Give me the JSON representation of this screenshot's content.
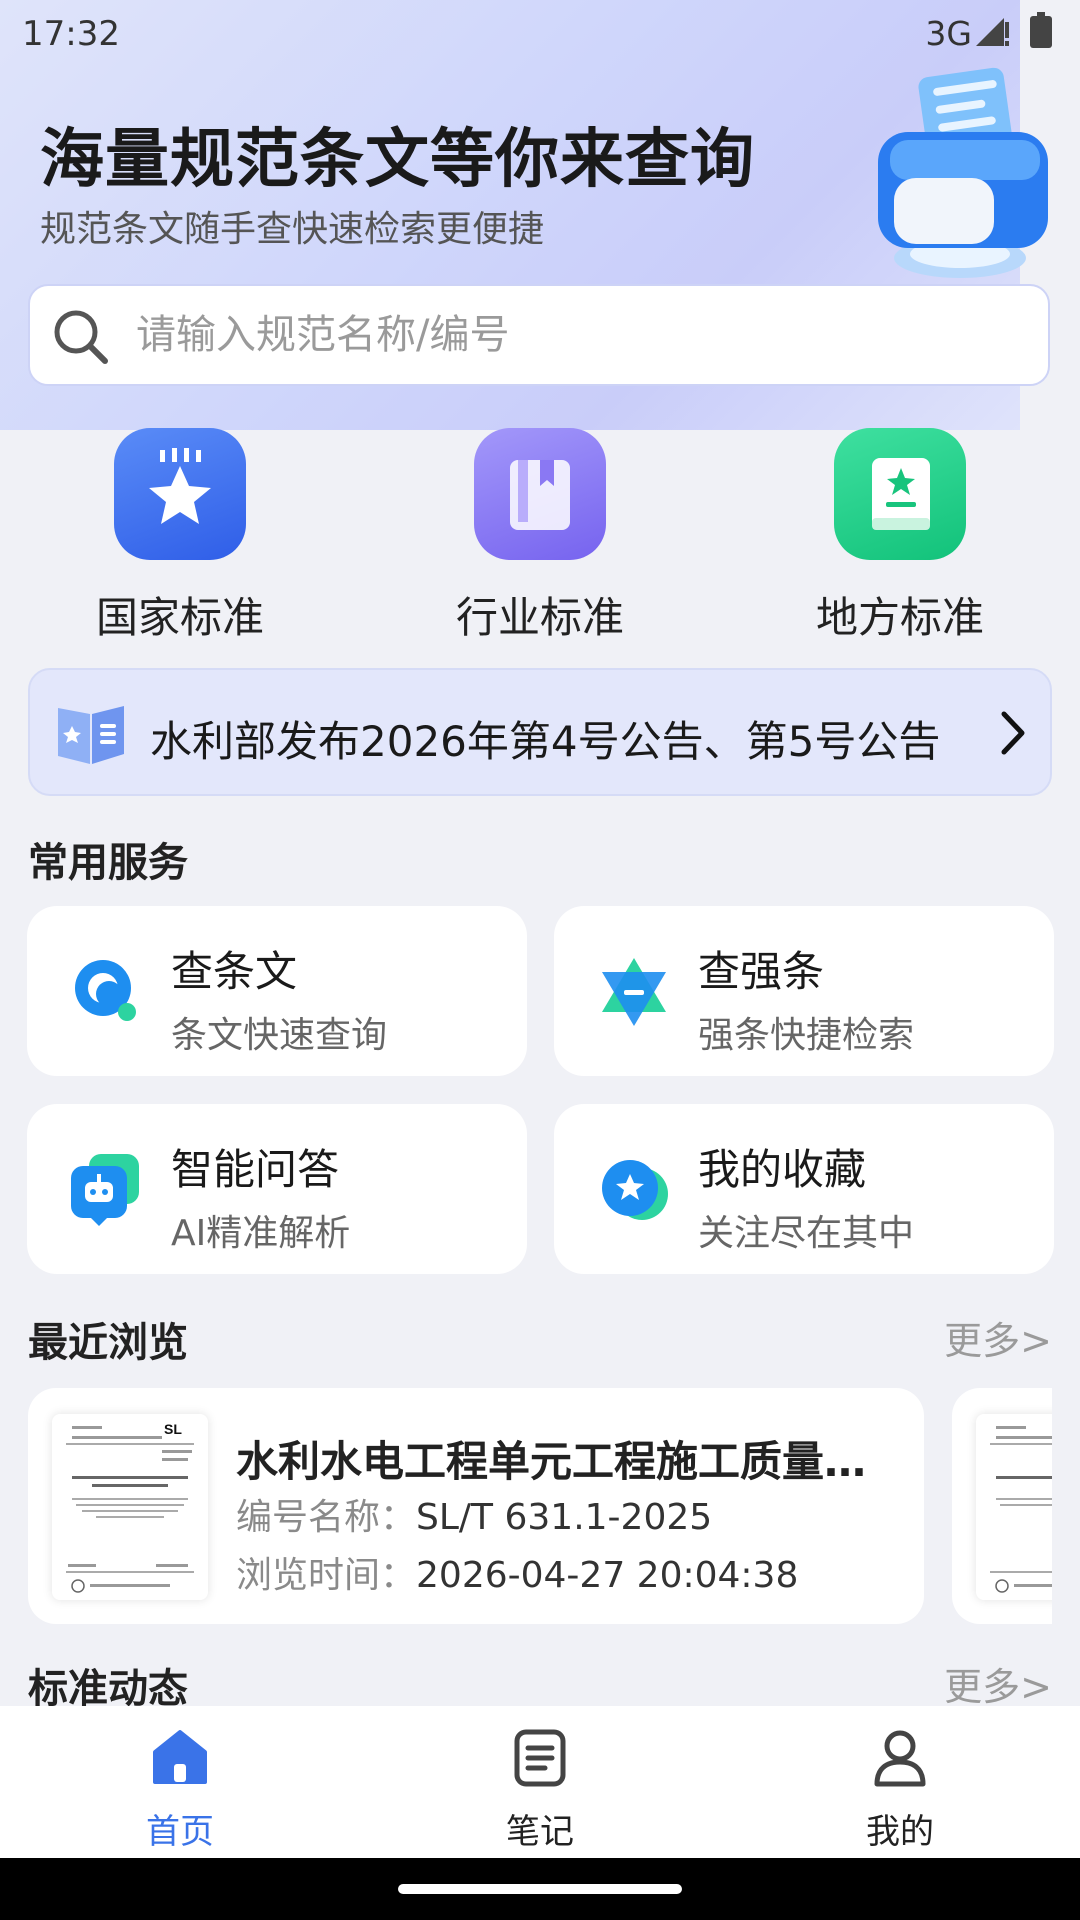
{
  "status_bar": {
    "time": "17:32",
    "network": "3G"
  },
  "hero": {
    "title": "海量规范条文等你来查询",
    "subtitle": "规范条文随手查快速检索更便捷"
  },
  "search": {
    "placeholder": "请输入规范名称/编号",
    "value": ""
  },
  "categories": [
    {
      "label": "国家标准",
      "icon": "star-badge-icon",
      "color": "#3f6ff0"
    },
    {
      "label": "行业标准",
      "icon": "book-icon",
      "color": "#8a78f3"
    },
    {
      "label": "地方标准",
      "icon": "star-book-icon",
      "color": "#1fce8a"
    }
  ],
  "notice": {
    "text": "水利部发布2026年第4号公告、第5号公告"
  },
  "services_section": {
    "title": "常用服务"
  },
  "services": [
    {
      "title": "查条文",
      "subtitle": "条文快速查询",
      "icon": "magnifier-icon"
    },
    {
      "title": "查强条",
      "subtitle": "强条快捷检索",
      "icon": "hexagram-icon"
    },
    {
      "title": "智能问答",
      "subtitle": "AI精准解析",
      "icon": "robot-icon"
    },
    {
      "title": "我的收藏",
      "subtitle": "关注尽在其中",
      "icon": "favorite-star-icon"
    }
  ],
  "recent_section": {
    "title": "最近浏览",
    "more": "更多>"
  },
  "recent_items": [
    {
      "title": "水利水电工程单元工程施工质量…",
      "code_label": "编号名称：",
      "code": "SL/T 631.1-2025",
      "time_label": "浏览时间：",
      "time": "2026-04-27 20:04:38",
      "thumb_badge": "SL"
    }
  ],
  "news_section": {
    "title": "标准动态",
    "more": "更多>"
  },
  "tabbar": [
    {
      "label": "首页",
      "icon": "home-icon",
      "active": true
    },
    {
      "label": "笔记",
      "icon": "note-icon",
      "active": false
    },
    {
      "label": "我的",
      "icon": "user-icon",
      "active": false
    }
  ],
  "colors": {
    "accent": "#3a73e8",
    "background": "#f0f1f6"
  }
}
